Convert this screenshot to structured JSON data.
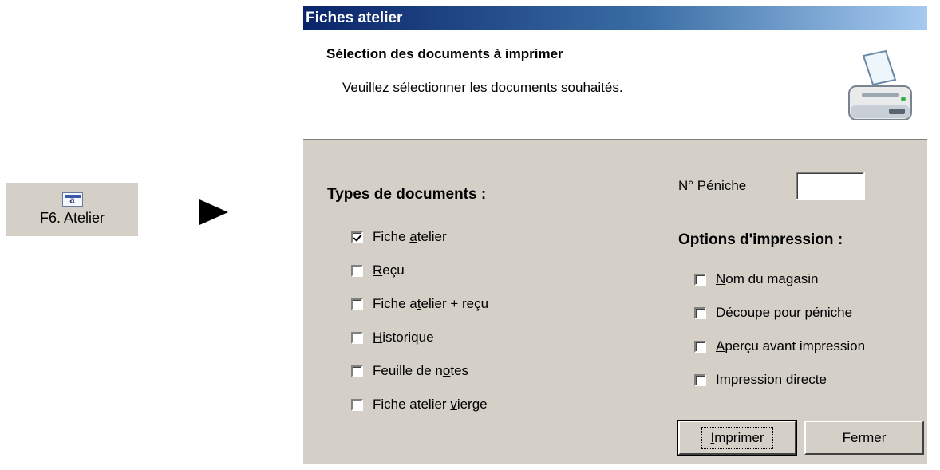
{
  "toolbar_button": {
    "icon_text": "a",
    "label": "F6. Atelier"
  },
  "dialog": {
    "title": "Fiches atelier",
    "header_title": "Sélection des documents à imprimer",
    "header_subtitle": "Veuillez sélectionner les documents souhaités.",
    "doc_types_label": "Types de documents :",
    "doc_types": [
      {
        "pre": "Fiche ",
        "u": "a",
        "post": "telier",
        "checked": true
      },
      {
        "pre": "",
        "u": "R",
        "post": "eçu",
        "checked": false
      },
      {
        "pre": "Fiche a",
        "u": "t",
        "post": "elier + reçu",
        "checked": false
      },
      {
        "pre": "",
        "u": "H",
        "post": "istorique",
        "checked": false
      },
      {
        "pre": "Feuille de n",
        "u": "o",
        "post": "tes",
        "checked": false
      },
      {
        "pre": "Fiche atelier ",
        "u": "v",
        "post": "ierge",
        "checked": false
      }
    ],
    "peniche_label": "N° Péniche",
    "peniche_value": "",
    "print_options_label": "Options d'impression :",
    "print_options": [
      {
        "pre": "",
        "u": "N",
        "post": "om du magasin",
        "checked": false
      },
      {
        "pre": "",
        "u": "D",
        "post": "écoupe pour péniche",
        "checked": false
      },
      {
        "pre": "",
        "u": "A",
        "post": "perçu avant impression",
        "checked": false
      },
      {
        "pre": "Impression ",
        "u": "d",
        "post": "irecte",
        "checked": false
      }
    ],
    "print_button": {
      "pre": "",
      "u": "I",
      "post": "mprimer"
    },
    "close_button": "Fermer"
  }
}
